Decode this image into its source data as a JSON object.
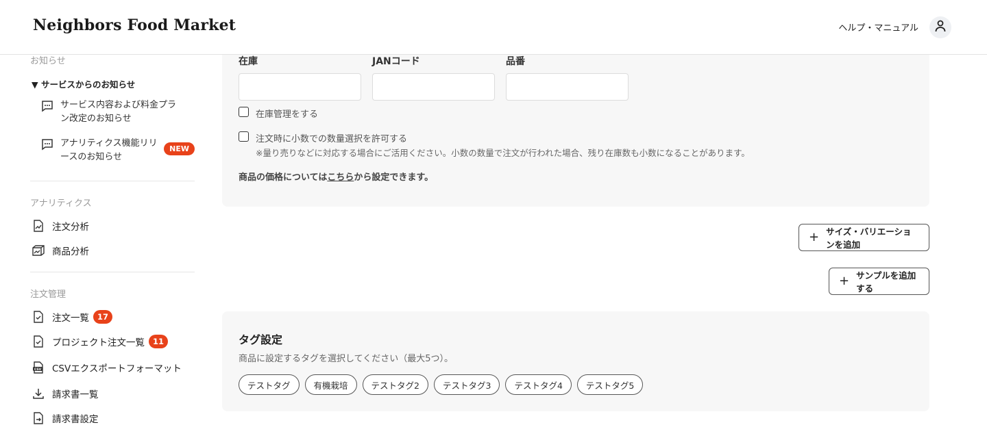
{
  "header": {
    "logo": "Neighbors Food Market",
    "help_label": "ヘルプ・マニュアル"
  },
  "sidebar": {
    "notices_title": "お知らせ",
    "service_group_title": "▼ サービスからのお知らせ",
    "notices": [
      {
        "label": "サービス内容および料金プラン改定のお知らせ",
        "badge": ""
      },
      {
        "label": "アナリティクス機能リリースのお知らせ",
        "badge": "NEW"
      }
    ],
    "analytics_title": "アナリティクス",
    "analytics_items": [
      {
        "label": "注文分析",
        "icon": "line-chart-doc-icon"
      },
      {
        "label": "商品分析",
        "icon": "cube-chart-icon"
      }
    ],
    "orders_title": "注文管理",
    "order_items": [
      {
        "label": "注文一覧",
        "count": "17",
        "icon": "doc-check-icon"
      },
      {
        "label": "プロジェクト注文一覧",
        "count": "11",
        "icon": "doc-check-icon"
      },
      {
        "label": "CSVエクスポートフォーマット",
        "count": "",
        "icon": "csv-icon"
      },
      {
        "label": "請求書一覧",
        "count": "",
        "icon": "download-icon"
      },
      {
        "label": "請求書設定",
        "count": "",
        "icon": "doc-arrow-icon"
      }
    ]
  },
  "form": {
    "stock_label": "在庫",
    "jan_label": "JANコード",
    "sku_label": "品番",
    "stock_value": "",
    "jan_value": "",
    "sku_value": "",
    "manage_stock_label": "在庫管理をする",
    "decimal_label": "注文時に小数での数量選択を許可する",
    "decimal_hint": "※量り売りなどに対応する場合にご活用ください。小数の数量で注文が行われた場合、残り在庫数も小数になることがあります。",
    "price_note_prefix": "商品の価格については",
    "price_note_link": "こちら",
    "price_note_suffix": "から設定できます。"
  },
  "actions": {
    "add_variation": "サイズ・バリエーションを追加",
    "add_sample": "サンプルを追加する"
  },
  "tags": {
    "title": "タグ設定",
    "description": "商品に設定するタグを選択してください（最大5つ）。",
    "items": [
      "テストタグ",
      "有機栽培",
      "テストタグ2",
      "テストタグ3",
      "テストタグ4",
      "テストタグ5"
    ]
  },
  "colors": {
    "accent_badge": "#e8421a",
    "card_bg": "#f7f7f7"
  }
}
